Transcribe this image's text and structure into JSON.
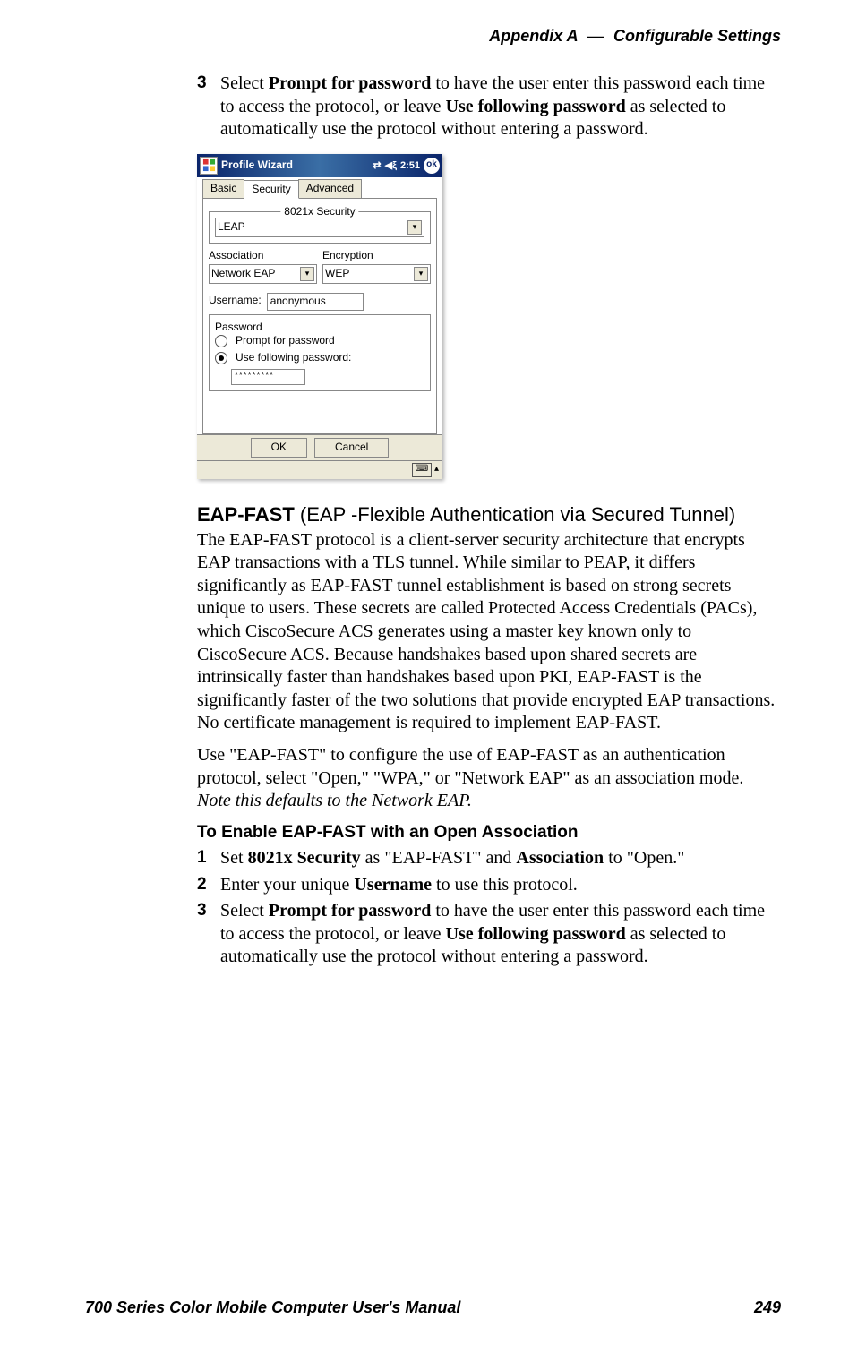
{
  "header": {
    "appendix": "Appendix A",
    "dash": "—",
    "section": "Configurable Settings"
  },
  "first_step": {
    "num": "3",
    "t1": "Select ",
    "b1": "Prompt for password",
    "t2": " to have the user enter this password each time to access the protocol, or leave ",
    "b2": "Use following password",
    "t3": " as selected to automatically use the protocol without entering a password."
  },
  "fig": {
    "title": "Profile Wizard",
    "time": "2:51",
    "ok": "ok",
    "tabs": {
      "basic": "Basic",
      "security": "Security",
      "advanced": "Advanced"
    },
    "sec_legend": "8021x Security",
    "sec_value": "LEAP",
    "assoc_lbl": "Association",
    "assoc_val": "Network EAP",
    "enc_lbl": "Encryption",
    "enc_val": "WEP",
    "user_lbl": "Username:",
    "user_val": "anonymous",
    "pass_legend": "Password",
    "radio1": "Prompt for password",
    "radio2": "Use following password:",
    "pwd_mask": "*********",
    "ok_btn": "OK",
    "cancel_btn": "Cancel"
  },
  "eap": {
    "title_bold": "EAP-FAST",
    "title_rest": " (EAP -Flexible Authentication via Secured Tunnel)",
    "p1": "The EAP-FAST protocol is a client-server security architecture that encrypts EAP transactions with a TLS tunnel. While similar to PEAP, it differs significantly as EAP-FAST tunnel establishment is based on strong secrets unique to users. These secrets are called Protected Access Credentials (PACs), which CiscoSecure ACS generates using a master key known only to CiscoSecure ACS. Because handshakes based upon shared secrets are intrinsically faster than handshakes based upon PKI, EAP-FAST is the significantly faster of the two solutions that provide encrypted EAP transactions. No certificate management is required to implement EAP-FAST.",
    "p2a": "Use \"EAP-FAST\" to configure the use of EAP-FAST as an authentication protocol, select \"Open,\" \"WPA,\" or \"Network EAP\" as an association mode. ",
    "p2i": "Note this defaults to the Network EAP.",
    "h4": "To Enable EAP-FAST with an Open Association",
    "steps": [
      {
        "num": "1",
        "pre": "Set ",
        "b1": "8021x Security",
        "mid": " as \"EAP-FAST\" and ",
        "b2": "Association",
        "post": " to \"Open.\""
      },
      {
        "num": "2",
        "pre": "Enter your unique ",
        "b1": "Username",
        "post": " to use this protocol."
      },
      {
        "num": "3",
        "pre": "Select ",
        "b1": "Prompt for password",
        "mid": " to have the user enter this password each time to access the protocol, or leave ",
        "b2": "Use following password",
        "post": " as selected to automatically use the protocol without entering a password."
      }
    ]
  },
  "footer": {
    "left": "700 Series Color Mobile Computer User's Manual",
    "right": "249"
  }
}
